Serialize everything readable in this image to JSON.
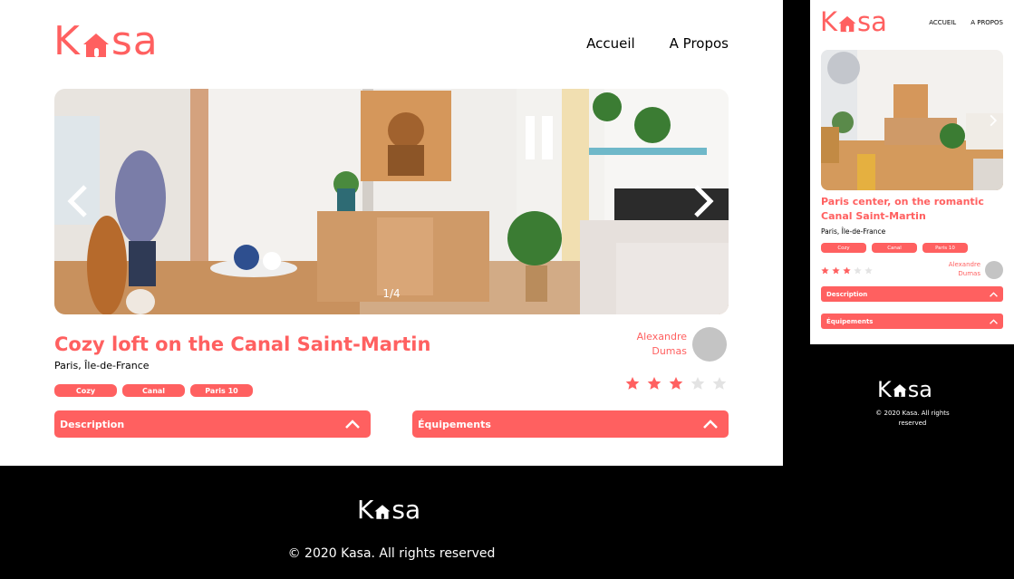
{
  "brand": {
    "letter_k": "K",
    "letters_end": "sa",
    "accent_color": "#ff6060"
  },
  "nav": {
    "home": "Accueil",
    "about": "A Propos"
  },
  "mobile_nav": {
    "home": "ACCUEIL",
    "about": "A PROPOS"
  },
  "listing": {
    "carousel": {
      "counter": "1/4",
      "prev_icon": "chevron-left-icon",
      "next_icon": "chevron-right-icon"
    },
    "title": "Cozy loft on the Canal Saint-Martin",
    "location": "Paris, Île-de-France",
    "tags": [
      "Cozy",
      "Canal",
      "Paris 10"
    ],
    "host": {
      "first_name": "Alexandre",
      "last_name": "Dumas"
    },
    "rating": {
      "value": 3,
      "max": 5,
      "filled_color": "#ff6060",
      "empty_color": "#e3e3e3"
    },
    "collapses": {
      "description": "Description",
      "equipments": "Équipements"
    }
  },
  "mobile_listing": {
    "title": "Paris center, on the romantic Canal Saint-Martin",
    "location": "Paris, Île-de-France",
    "tags": [
      "Cozy",
      "Canal",
      "Paris 10"
    ],
    "host": {
      "first_name": "Alexandre",
      "last_name": "Dumas"
    },
    "rating": {
      "value": 3,
      "max": 5
    },
    "collapses": {
      "description": "Description",
      "equipments": "Équipements"
    }
  },
  "footer": {
    "copyright": "© 2020 Kasa. All rights reserved"
  },
  "mobile_footer": {
    "copyright": "© 2020 Kasa. All rights reserved"
  }
}
